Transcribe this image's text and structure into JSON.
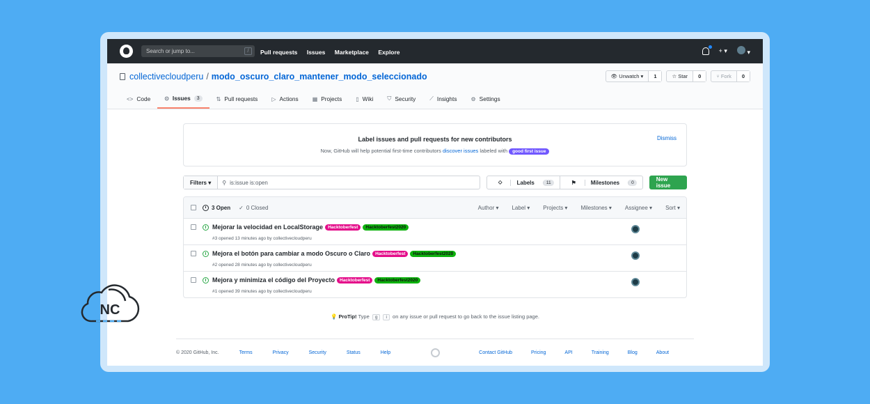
{
  "colors": {
    "background": "#4eacf3",
    "topbar": "#24292e",
    "accent_link": "#0366d6",
    "new_issue_green": "#2ea44f",
    "hacktoberfest": "#e40d8a",
    "hacktoberfest2020": "#0eb20e",
    "good_first_issue": "#7057ff"
  },
  "header": {
    "search_placeholder": "Search or jump to...",
    "search_shortcut": "/",
    "nav": [
      "Pull requests",
      "Issues",
      "Marketplace",
      "Explore"
    ],
    "plus_label": "+ ▾",
    "avatar_caret": "▾"
  },
  "repo": {
    "owner": "collectivecloudperu",
    "separator": "/",
    "name": "modo_oscuro_claro_mantener_modo_seleccionado",
    "watch_label": "Unwatch ▾",
    "watch_count": "1",
    "star_label": "Star",
    "star_count": "0",
    "fork_label": "Fork",
    "fork_count": "0"
  },
  "tabs": [
    {
      "label": "Code",
      "icon": "code-icon"
    },
    {
      "label": "Issues",
      "badge": "3",
      "icon": "issue-icon"
    },
    {
      "label": "Pull requests",
      "icon": "pr-icon"
    },
    {
      "label": "Actions",
      "icon": "play-icon"
    },
    {
      "label": "Projects",
      "icon": "project-icon"
    },
    {
      "label": "Wiki",
      "icon": "book-icon"
    },
    {
      "label": "Security",
      "icon": "shield-icon"
    },
    {
      "label": "Insights",
      "icon": "graph-icon"
    },
    {
      "label": "Settings",
      "icon": "gear-icon"
    }
  ],
  "banner": {
    "title": "Label issues and pull requests for new contributors",
    "text_before": "Now, GitHub will help potential first-time contributors ",
    "link": "discover issues",
    "text_after": " labeled with ",
    "label": "good first issue",
    "dismiss": "Dismiss"
  },
  "filterbar": {
    "filters_label": "Filters ▾",
    "query": "is:issue is:open",
    "labels_label": "Labels",
    "labels_count": "11",
    "milestones_label": "Milestones",
    "milestones_count": "0",
    "new_issue": "New issue"
  },
  "issues_header": {
    "open": "3 Open",
    "closed": "0 Closed",
    "sorts": [
      "Author ▾",
      "Label ▾",
      "Projects ▾",
      "Milestones ▾",
      "Assignee ▾",
      "Sort ▾"
    ]
  },
  "issues": [
    {
      "title": "Mejorar la velocidad en LocalStorage",
      "labels": [
        "Hacktoberfest",
        "Hacktoberfest2020"
      ],
      "meta": "#3 opened 13 minutes ago by collectivecloudperu"
    },
    {
      "title": "Mejora el botón para cambiar a modo Oscuro o Claro",
      "labels": [
        "Hacktoberfest",
        "Hacktoberfest2020"
      ],
      "meta": "#2 opened 28 minutes ago by collectivecloudperu"
    },
    {
      "title": "Mejora y minimiza el código del Proyecto",
      "labels": [
        "Hacktoberfest",
        "Hacktoberfest2020"
      ],
      "meta": "#1 opened 39 minutes ago by collectivecloudperu"
    }
  ],
  "protip": {
    "bold": "ProTip!",
    "before": " Type ",
    "key1": "g",
    "key2": "i",
    "after": " on any issue or pull request to go back to the issue listing page."
  },
  "footer": {
    "copyright": "© 2020 GitHub, Inc.",
    "left_links": [
      "Terms",
      "Privacy",
      "Security",
      "Status",
      "Help"
    ],
    "right_links": [
      "Contact GitHub",
      "Pricing",
      "API",
      "Training",
      "Blog",
      "About"
    ]
  },
  "logo": {
    "text": "NC"
  }
}
